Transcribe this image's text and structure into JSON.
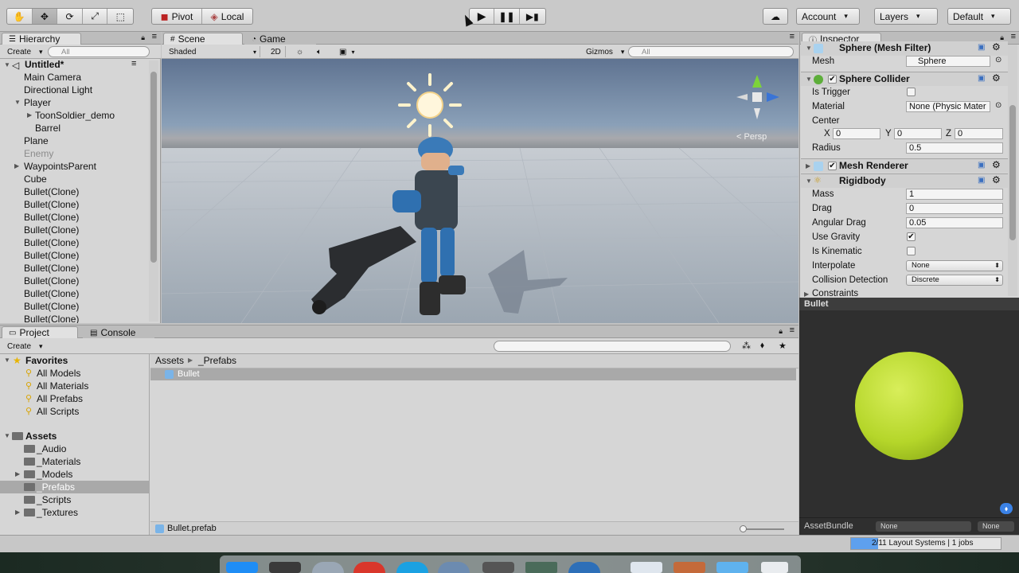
{
  "toolbar": {
    "pivot": "Pivot",
    "local": "Local",
    "account": "Account",
    "layers": "Layers",
    "layout": "Default"
  },
  "hierarchy": {
    "tab": "Hierarchy",
    "create": "Create",
    "search_placeholder": "All",
    "scene": "Untitled*",
    "items": [
      "Main Camera",
      "Directional Light",
      "Player",
      "ToonSoldier_demo",
      "Barrel",
      "Plane",
      "Enemy",
      "WaypointsParent",
      "Cube",
      "Bullet(Clone)",
      "Bullet(Clone)",
      "Bullet(Clone)",
      "Bullet(Clone)",
      "Bullet(Clone)",
      "Bullet(Clone)",
      "Bullet(Clone)",
      "Bullet(Clone)",
      "Bullet(Clone)",
      "Bullet(Clone)",
      "Bullet(Clone)"
    ]
  },
  "scene_view": {
    "tab_scene": "Scene",
    "tab_game": "Game",
    "shading": "Shaded",
    "mode_2d": "2D",
    "gizmos": "Gizmos",
    "search_placeholder": "All",
    "persp": "Persp"
  },
  "inspector": {
    "tab": "Inspector",
    "mesh_filter": {
      "title": "Sphere (Mesh Filter)",
      "mesh_label": "Mesh",
      "mesh_value": "Sphere"
    },
    "sphere_collider": {
      "title": "Sphere Collider",
      "is_trigger": "Is Trigger",
      "material": "Material",
      "material_value": "None (Physic Mater",
      "center": "Center",
      "x": "X",
      "x_val": "0",
      "y": "Y",
      "y_val": "0",
      "z": "Z",
      "z_val": "0",
      "radius": "Radius",
      "radius_val": "0.5"
    },
    "mesh_renderer": {
      "title": "Mesh Renderer"
    },
    "rigidbody": {
      "title": "Rigidbody",
      "mass": "Mass",
      "mass_val": "1",
      "drag": "Drag",
      "drag_val": "0",
      "angular_drag": "Angular Drag",
      "angular_drag_val": "0.05",
      "use_gravity": "Use Gravity",
      "is_kinematic": "Is Kinematic",
      "interpolate": "Interpolate",
      "interpolate_val": "None",
      "collision_detection": "Collision Detection",
      "collision_detection_val": "Discrete",
      "constraints": "Constraints"
    },
    "preview": {
      "title": "Bullet",
      "sphere_color": "#b5d62a"
    },
    "asset_bundle": {
      "label": "AssetBundle",
      "value1": "None",
      "value2": "None"
    }
  },
  "project": {
    "tab_project": "Project",
    "tab_console": "Console",
    "create": "Create",
    "favorites": "Favorites",
    "favorite_items": [
      "All Models",
      "All Materials",
      "All Prefabs",
      "All Scripts"
    ],
    "assets": "Assets",
    "folders": [
      "_Audio",
      "_Materials",
      "_Models",
      "_Prefabs",
      "_Scripts",
      "_Textures"
    ],
    "breadcrumb": [
      "Assets",
      "_Prefabs"
    ],
    "files": [
      "Bullet"
    ],
    "selected_file": "Bullet.prefab"
  },
  "status": {
    "progress": "2/11 Layout Systems | 1 jobs"
  }
}
